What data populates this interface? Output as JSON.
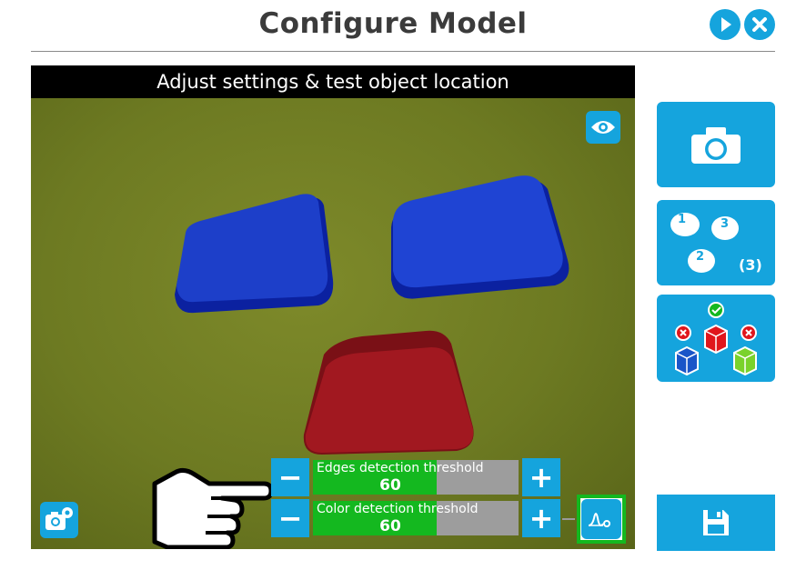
{
  "header": {
    "title": "Configure Model",
    "play_icon": "play-icon",
    "close_icon": "close-icon"
  },
  "viewport": {
    "caption": "Adjust settings & test object location",
    "eye_icon": "eye-icon",
    "camera_settings_icon": "camera-settings-icon",
    "objects": [
      "blue-block",
      "blue-block",
      "red-block"
    ]
  },
  "controls": {
    "edges": {
      "label": "Edges detection threshold",
      "value": "60",
      "level_fraction": 0.6
    },
    "color": {
      "label": "Color detection threshold",
      "value": "60",
      "level_fraction": 0.6
    },
    "minus_label": "−",
    "plus_label": "+",
    "wave_icon": "waveform-icon"
  },
  "sidebar": {
    "camera_icon": "camera-icon",
    "models": {
      "badges": [
        "1",
        "3",
        "2"
      ],
      "count": "(3)"
    },
    "color_check_icon": "colored-cubes-icon",
    "save_icon": "floppy-disk-icon"
  },
  "colors": {
    "accent": "#15a4dd",
    "slider_fill": "#14b81f",
    "slider_track": "#9d9d9d",
    "blue_object": "#1d3fc9",
    "red_object": "#a11820"
  }
}
